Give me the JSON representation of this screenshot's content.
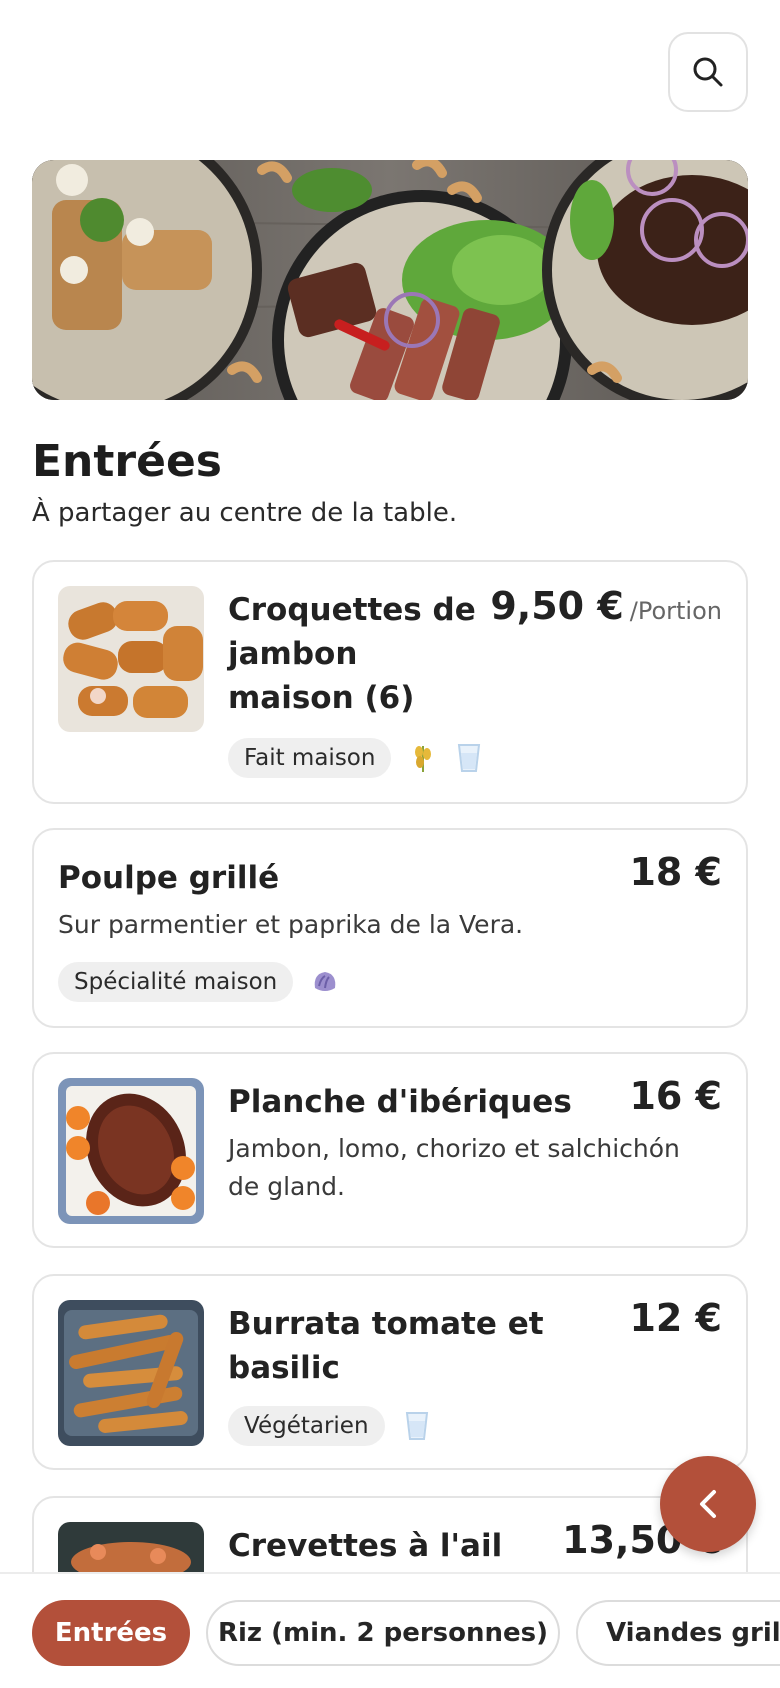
{
  "colors": {
    "accent": "#b3503a",
    "card_border": "#e4e4e4",
    "tag_bg": "#efefef"
  },
  "header": {
    "search_icon": "search-icon"
  },
  "section": {
    "title": "Entrées",
    "subtitle": "À partager au centre de la table."
  },
  "items": [
    {
      "name_lines": [
        "Croquettes de",
        "jambon",
        "maison (6)"
      ],
      "price": "9,50 €",
      "unit": "/Portion",
      "tag": "Fait maison",
      "allergens": [
        "wheat-icon",
        "milk-glass-icon"
      ]
    },
    {
      "name": "Poulpe grillé",
      "description": "Sur parmentier et paprika de la Vera.",
      "price": "18 €",
      "tag": "Spécialité maison",
      "allergens": [
        "shellfish-icon"
      ]
    },
    {
      "name": "Planche d'ibériques",
      "description_lines": [
        "Jambon, lomo, chorizo et salchichón",
        "de gland."
      ],
      "price": "16 €"
    },
    {
      "name_lines": [
        "Burrata tomate et",
        "basilic"
      ],
      "price": "12 €",
      "tag": "Végétarien",
      "allergens": [
        "milk-glass-icon"
      ]
    },
    {
      "name": "Crevettes à l'ail",
      "price": "13,50 €"
    }
  ],
  "bottom_nav": {
    "categories": [
      "Entrées",
      "Riz (min. 2 personnes)",
      "Viandes grillé"
    ],
    "active_index": 0
  }
}
